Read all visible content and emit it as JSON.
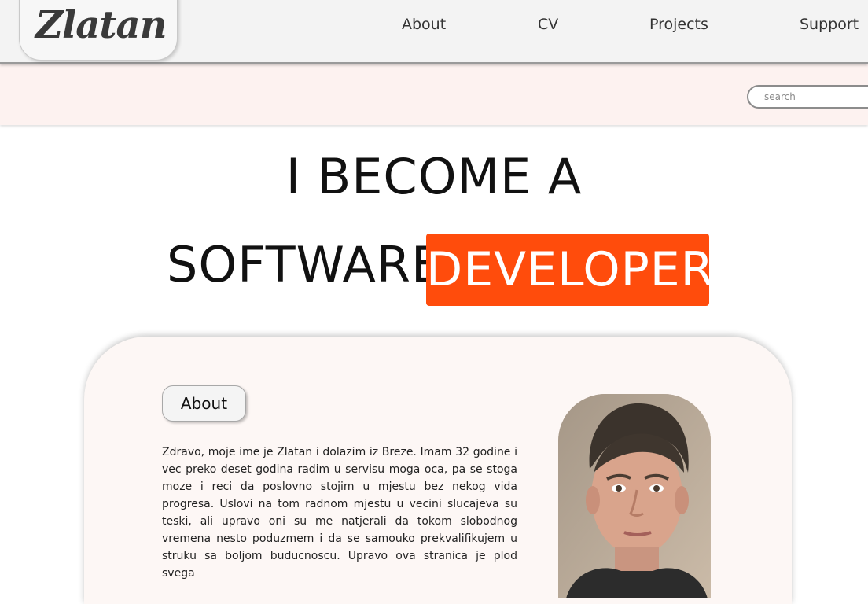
{
  "logo": {
    "text": "Zlatan"
  },
  "nav": {
    "about": "About",
    "cv": "CV",
    "projects": "Projects",
    "support": "Support"
  },
  "search": {
    "placeholder": "search",
    "value": ""
  },
  "hero": {
    "line1": "I BECOME A",
    "line2": "SOFTWARE",
    "highlight": "DEVELOPER!",
    "highlight_color": "#ff4c0c"
  },
  "about": {
    "tab_label": "About",
    "text": "Zdravo, moje ime je Zlatan i dolazim iz Breze. Imam 32 godine i vec preko deset godina radim u servisu moga oca, pa se stoga moze i reci da poslovno stojim u mjestu bez nekog vida progresa. Uslovi na tom radnom mjestu u vecini slucajeva su teski, ali upravo oni su me natjerali da tokom slobodnog vremena nesto poduzmem i da se samouko prekvalifikujem u struku sa boljom buducnoscu. Upravo ova stranica je plod svega"
  },
  "colors": {
    "header_bg": "#f3f3f3",
    "band_bg": "#fdf2f0",
    "card_bg": "#fdf7f5",
    "accent": "#ff4c0c"
  }
}
